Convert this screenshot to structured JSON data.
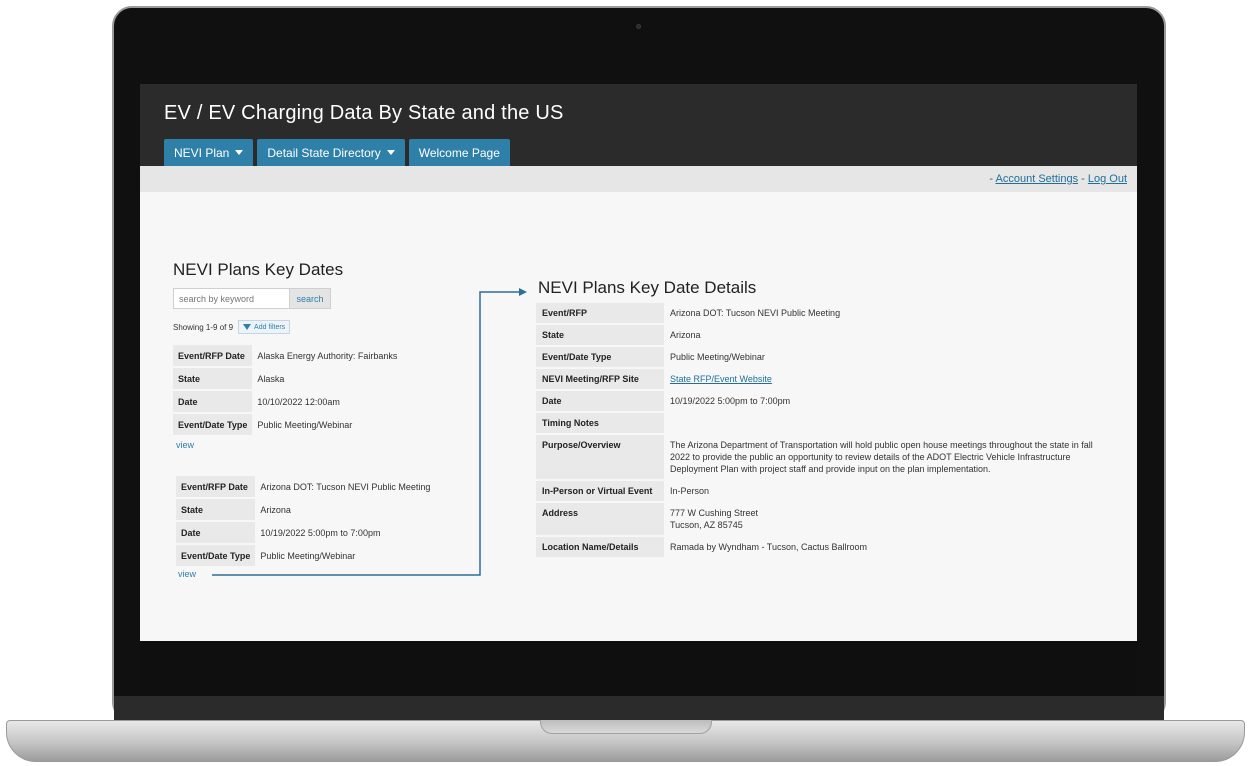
{
  "app": {
    "title": "EV / EV Charging Data By State and the US",
    "nav": [
      {
        "label": "NEVI Plan",
        "has_dropdown": true
      },
      {
        "label": "Detail State Directory",
        "has_dropdown": true
      },
      {
        "label": "Welcome Page",
        "has_dropdown": false
      }
    ],
    "account": {
      "prefix": "- ",
      "settings_label": "Account Settings",
      "separator": " - ",
      "logout_label": "Log Out"
    }
  },
  "colors": {
    "header_bg": "#2b2b2b",
    "accent": "#2e80a8",
    "link": "#1f6f9a",
    "label_bg": "#e9e9e9"
  },
  "left": {
    "title": "NEVI Plans Key Dates",
    "search": {
      "placeholder": "search by keyword",
      "button": "search"
    },
    "showing": "Showing 1-9 of 9",
    "filter_button": "Add filters",
    "records": [
      {
        "rows": [
          {
            "label": "Event/RFP Date",
            "value": "Alaska Energy Authority: Fairbanks"
          },
          {
            "label": "State",
            "value": "Alaska"
          },
          {
            "label": "Date",
            "value": "10/10/2022 12:00am"
          },
          {
            "label": "Event/Date Type",
            "value": "Public Meeting/Webinar"
          }
        ],
        "view_label": "view"
      },
      {
        "rows": [
          {
            "label": "Event/RFP Date",
            "value": "Arizona DOT: Tucson NEVI Public Meeting"
          },
          {
            "label": "State",
            "value": "Arizona"
          },
          {
            "label": "Date",
            "value": "10/19/2022 5:00pm to 7:00pm"
          },
          {
            "label": "Event/Date Type",
            "value": "Public Meeting/Webinar"
          }
        ],
        "view_label": "view"
      }
    ]
  },
  "right": {
    "title": "NEVI Plans Key Date Details",
    "rows": [
      {
        "label": "Event/RFP",
        "value": "Arizona DOT: Tucson NEVI Public Meeting"
      },
      {
        "label": "State",
        "value": "Arizona"
      },
      {
        "label": "Event/Date Type",
        "value": "Public Meeting/Webinar"
      },
      {
        "label": "NEVI Meeting/RFP Site",
        "value": "State RFP/Event Website"
      },
      {
        "label": "Date",
        "value": "10/19/2022 5:00pm to 7:00pm"
      },
      {
        "label": "Timing Notes",
        "value": ""
      },
      {
        "label": "Purpose/Overview",
        "value": "The Arizona Department of Transportation will hold public open house meetings throughout the state in fall 2022 to provide the public an opportunity to review details of the ADOT Electric Vehicle Infrastructure Deployment Plan with project staff and provide input on the plan implementation."
      },
      {
        "label": "In-Person or Virtual Event",
        "value": "In-Person"
      },
      {
        "label": "Address",
        "value_lines": [
          "777 W Cushing Street",
          "Tucson, AZ 85745"
        ]
      },
      {
        "label": "Location Name/Details",
        "value": "Ramada by Wyndham - Tucson, Cactus Ballroom"
      }
    ]
  }
}
